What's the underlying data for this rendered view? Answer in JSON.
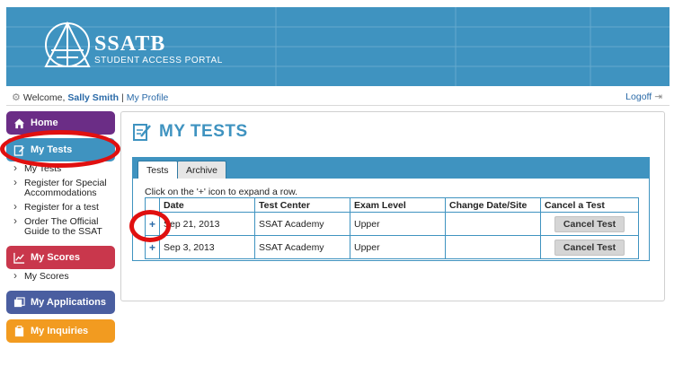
{
  "header": {
    "brand": "SSATB",
    "subtitle": "STUDENT ACCESS PORTAL"
  },
  "welcome": {
    "prefix": "Welcome,",
    "user": "Sally Smith",
    "separator": "|",
    "profile_link": "My Profile",
    "logoff": "Logoff"
  },
  "sidebar": {
    "home": "Home",
    "my_tests": "My Tests",
    "tests_items": [
      "My Tests",
      "Register for Special Accommodations",
      "Register for a test",
      "Order The Official Guide to the SSAT"
    ],
    "my_scores": "My Scores",
    "scores_items": [
      "My Scores"
    ],
    "my_applications": "My Applications",
    "my_inquiries": "My Inquiries"
  },
  "main": {
    "title": "MY TESTS",
    "tabs": [
      "Tests",
      "Archive"
    ],
    "hint": "Click on the '+' icon to expand a row.",
    "columns": [
      "Date",
      "Test Center",
      "Exam Level",
      "Change Date/Site",
      "Cancel a Test"
    ],
    "rows": [
      {
        "expand": "+",
        "date": "Sep 21, 2013",
        "center": "SSAT Academy",
        "level": "Upper",
        "change": "",
        "cancel": "Cancel Test"
      },
      {
        "expand": "+",
        "date": "Sep 3, 2013",
        "center": "SSAT Academy",
        "level": "Upper",
        "change": "",
        "cancel": "Cancel Test"
      }
    ]
  },
  "colors": {
    "primary_blue": "#3f93c0",
    "home_purple": "#6b2d86",
    "scores_red": "#c9374c",
    "applications_blue": "#4a5ea0",
    "inquiries_orange": "#f29b20",
    "annotation_red": "#e01010"
  },
  "icons": {
    "home": "house-icon",
    "tests": "pencil-note-icon",
    "scores": "chart-icon",
    "applications": "stack-icon",
    "inquiries": "clipboard-icon",
    "welcome": "gear-icon",
    "logoff": "logout-icon"
  }
}
